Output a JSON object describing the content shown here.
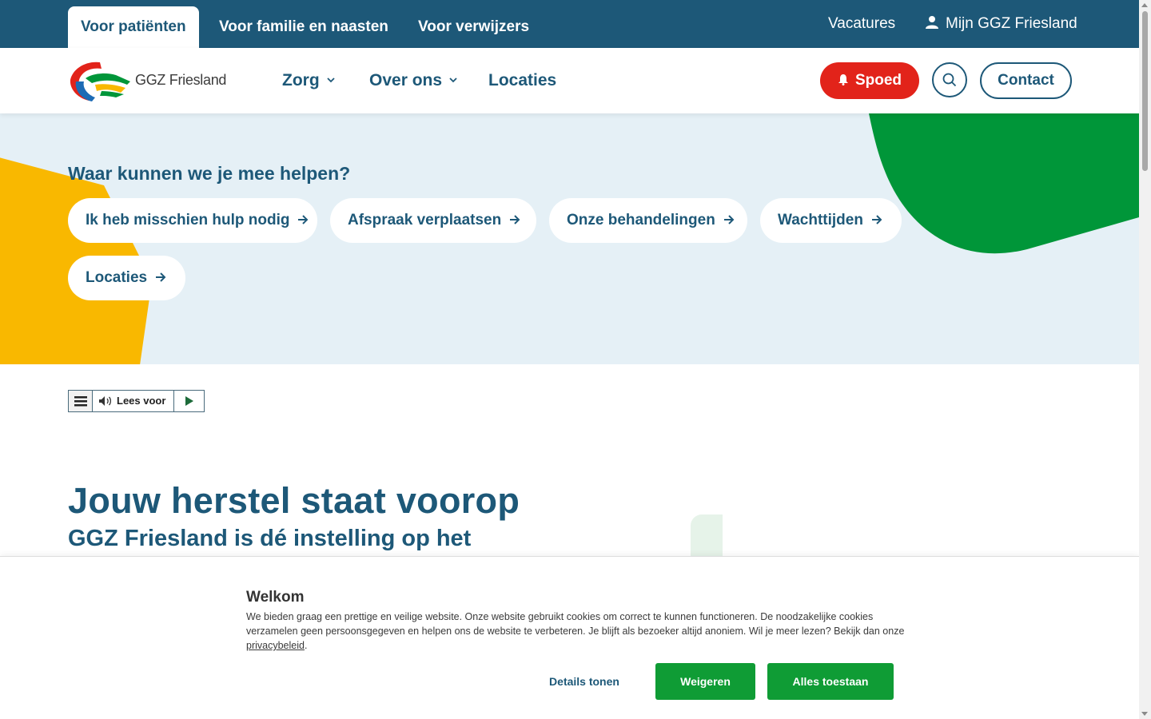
{
  "topbar": {
    "tabs": [
      {
        "label": "Voor patiënten",
        "active": true
      },
      {
        "label": "Voor familie en naasten",
        "active": false
      },
      {
        "label": "Voor verwijzers",
        "active": false
      }
    ],
    "vacatures": "Vacatures",
    "account": "Mijn GGZ Friesland"
  },
  "header": {
    "logo_text": "GGZ Friesland",
    "nav": [
      {
        "label": "Zorg",
        "dropdown": true
      },
      {
        "label": "Over ons",
        "dropdown": true
      },
      {
        "label": "Locaties",
        "dropdown": false
      }
    ],
    "spoed": "Spoed",
    "contact": "Contact"
  },
  "hero": {
    "title": "Waar kunnen we je mee helpen?",
    "quicklinks": [
      "Ik heb misschien hulp nodig",
      "Afspraak verplaatsen",
      "Onze behandelingen",
      "Wachttijden",
      "Locaties"
    ]
  },
  "readspeaker": {
    "label": "Lees voor"
  },
  "main": {
    "title": "Jouw herstel staat voorop",
    "subtitle": "GGZ Friesland is dé instelling op het"
  },
  "cookie": {
    "title": "Welkom",
    "text": "We bieden graag een prettige en veilige website. Onze website gebruikt cookies om correct te kunnen functioneren. De noodzakelijke cookies verzamelen geen persoonsgegeven en helpen ons de website te verbeteren. Je blijft als bezoeker altijd anoniem. Wil je meer lezen? Bekijk dan onze ",
    "link": "privacybeleid",
    "text_end": ".",
    "details": "Details tonen",
    "refuse": "Weigeren",
    "accept": "Alles toestaan"
  },
  "colors": {
    "primary": "#1d5878",
    "spoed": "#e2231a",
    "hero_bg": "#e5f0f6",
    "yellow": "#f9b800",
    "green": "#009639",
    "cookie_button": "#0f9c35"
  }
}
